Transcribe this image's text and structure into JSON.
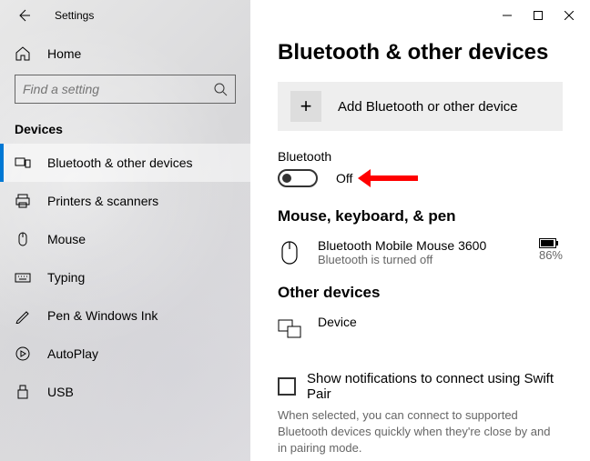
{
  "titlebar": {
    "app_title": "Settings"
  },
  "sidebar": {
    "home_label": "Home",
    "search_placeholder": "Find a setting",
    "group_header": "Devices",
    "items": [
      {
        "label": "Bluetooth & other devices"
      },
      {
        "label": "Printers & scanners"
      },
      {
        "label": "Mouse"
      },
      {
        "label": "Typing"
      },
      {
        "label": "Pen & Windows Ink"
      },
      {
        "label": "AutoPlay"
      },
      {
        "label": "USB"
      }
    ]
  },
  "main": {
    "heading": "Bluetooth & other devices",
    "add_device_label": "Add Bluetooth or other device",
    "bluetooth": {
      "label": "Bluetooth",
      "status": "Off"
    },
    "section_mouse": {
      "heading": "Mouse, keyboard, & pen",
      "device_name": "Bluetooth Mobile Mouse 3600",
      "device_status": "Bluetooth is turned off",
      "battery_pct": "86%"
    },
    "section_other": {
      "heading": "Other devices",
      "device_name": "Device"
    },
    "swift_pair": {
      "label": "Show notifications to connect using Swift Pair",
      "help": "When selected, you can connect to supported Bluetooth devices quickly when they're close by and in pairing mode."
    }
  }
}
